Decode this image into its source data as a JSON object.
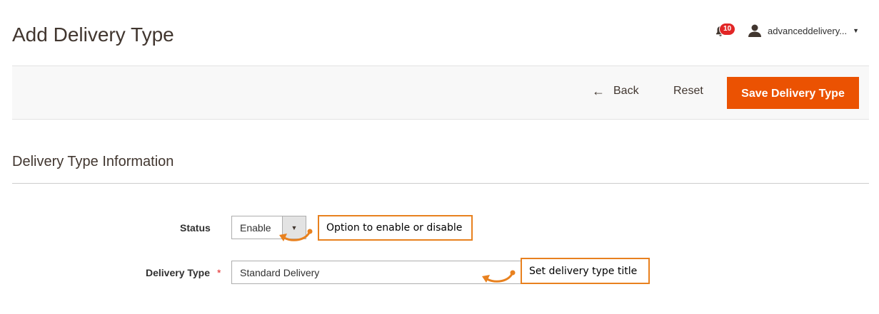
{
  "header": {
    "title": "Add Delivery Type",
    "notifications_count": "10",
    "user_name": "advanceddelivery..."
  },
  "toolbar": {
    "back_label": "Back",
    "reset_label": "Reset",
    "save_label": "Save Delivery Type"
  },
  "section": {
    "title": "Delivery Type Information"
  },
  "form": {
    "status": {
      "label": "Status",
      "value": "Enable"
    },
    "delivery_type": {
      "label": "Delivery Type",
      "required_marker": "*",
      "value": "Standard Delivery"
    }
  },
  "annotations": {
    "status_note": "Option to enable or disable",
    "title_note": "Set delivery type title"
  },
  "colors": {
    "accent": "#eb5202",
    "callout_border": "#e8811f",
    "badge": "#e22626"
  },
  "icons": {
    "notification": "bell-icon",
    "user": "user-icon",
    "back": "arrow-left-icon",
    "dropdown": "caret-down-icon"
  }
}
